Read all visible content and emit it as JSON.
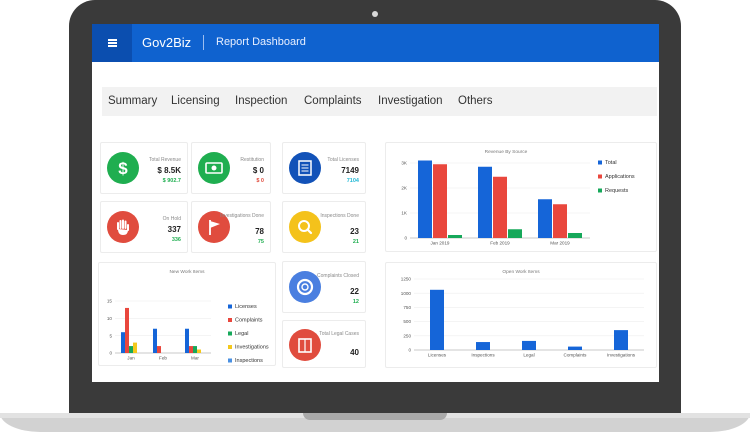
{
  "header": {
    "brand": "Gov2Biz",
    "page_title": "Report Dashboard"
  },
  "nav": {
    "tabs": [
      "Summary",
      "Licensing",
      "Inspection",
      "Complaints",
      "Investigation",
      "Others"
    ]
  },
  "kpis": {
    "revenue": {
      "label": "Total Revenue",
      "value": "$ 8.5K",
      "sub": "$ 902.7",
      "sub_color": "#1fae50",
      "icon": "dollar-icon",
      "color": "#1fae50"
    },
    "restitution": {
      "label": "Restitution",
      "value": "$ 0",
      "sub": "$ 0",
      "sub_color": "#e04c3e",
      "icon": "banknote-icon",
      "color": "#1fae50"
    },
    "licenses": {
      "label": "Total Licenses",
      "value": "7149",
      "sub": "7104",
      "sub_color": "#22b9d6",
      "icon": "license-list-icon",
      "color": "#1252b8"
    },
    "on_hold": {
      "label": "On Hold",
      "value": "337",
      "sub": "336",
      "sub_color": "#1fae50",
      "icon": "hand-stop-icon",
      "color": "#e04c3e"
    },
    "investigations": {
      "label": "Investigations Done",
      "value": "78",
      "sub": "75",
      "sub_color": "#1fae50",
      "icon": "flag-icon",
      "color": "#e04c3e"
    },
    "inspections": {
      "label": "Inspections Done",
      "value": "23",
      "sub": "21",
      "sub_color": "#1fae50",
      "icon": "magnifier-icon",
      "color": "#f4c21b"
    },
    "complaints": {
      "label": "Complaints Closed",
      "value": "22",
      "sub": "12",
      "sub_color": "#1fae50",
      "icon": "lifebuoy-icon",
      "color": "#4a7fe0"
    },
    "legal": {
      "label": "Total Legal Cases",
      "value": "40",
      "icon": "law-book-icon",
      "color": "#e04c3e"
    }
  },
  "colors": {
    "blue": "#1565d8",
    "red": "#e9473d",
    "green": "#16a85a",
    "yellow": "#f4c81c",
    "lightblue": "#4a90e2"
  },
  "chart_data": [
    {
      "type": "bar",
      "title": "Revenue By Source",
      "categories": [
        "Jan 2019",
        "Feb 2019",
        "Mar 2019"
      ],
      "series": [
        {
          "name": "Total",
          "values": [
            3100,
            2850,
            1550
          ]
        },
        {
          "name": "Applications",
          "values": [
            2950,
            2450,
            1350
          ]
        },
        {
          "name": "Requests",
          "values": [
            120,
            350,
            200
          ]
        }
      ],
      "ylim": [
        0,
        3000
      ],
      "yticks": [
        "0",
        "1K",
        "2K",
        "3K"
      ],
      "legend": "right"
    },
    {
      "type": "bar",
      "title": "New Work Items",
      "categories": [
        "Jan",
        "Feb",
        "Mar"
      ],
      "series": [
        {
          "name": "Licenses",
          "values": [
            6,
            7,
            7
          ]
        },
        {
          "name": "Complaints",
          "values": [
            13,
            2,
            2
          ]
        },
        {
          "name": "Legal",
          "values": [
            2,
            0,
            2
          ]
        },
        {
          "name": "Investigations",
          "values": [
            3,
            0,
            1
          ]
        },
        {
          "name": "Inspections",
          "values": [
            0,
            0,
            0
          ]
        }
      ],
      "ylim": [
        0,
        15
      ],
      "yticks": [
        "0",
        "5",
        "10",
        "15"
      ],
      "legend": "right"
    },
    {
      "type": "bar",
      "title": "Open Work Items",
      "categories": [
        "Licenses",
        "Inspections",
        "Legal",
        "Complaints",
        "Investigations"
      ],
      "series": [
        {
          "values": [
            1060,
            140,
            160,
            60,
            350
          ]
        }
      ],
      "ylim": [
        0,
        1250
      ],
      "yticks": [
        "0",
        "250",
        "500",
        "750",
        "1000",
        "1250"
      ],
      "legend": "none"
    }
  ]
}
